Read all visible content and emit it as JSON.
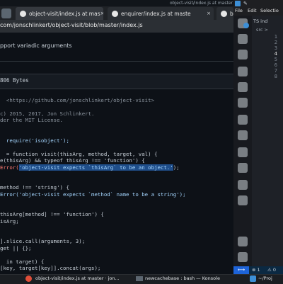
{
  "browser": {
    "window_title": "object-visit/index.js at master · jonsc",
    "tabs": [
      {
        "label": "object-visit/index.js at mas"
      },
      {
        "label": "enquirer/index.js at maste"
      },
      {
        "label": "bas"
      }
    ],
    "url": "com/jonschlinkert/object-visit/blob/master/index.js",
    "commit_message": "pport variadic arguments",
    "file_size": "806 Bytes",
    "code_lines": [
      "",
      "  <https://github.com/jonschlinkert/object-visit>",
      "",
      "c) 2015, 2017, Jon Schlinkert.",
      "der the MIT License.",
      "",
      "",
      "  require('isobject');",
      "",
      "  = function visit(thisArg, method, target, val) {",
      "e(thisArg) && typeof thisArg !== 'function') {",
      "Error('object-visit expects `thisArg` to be an object.');",
      "",
      "",
      "method !== 'string') {",
      "Error('object-visit expects `method` name to be a string');",
      "",
      "",
      "thisArg[method] !== 'function') {",
      "isArg;",
      "",
      "",
      "].slice.call(arguments, 3);",
      "get || {};",
      "",
      "  in target) {",
      "[key, target[key]].concat(args);"
    ]
  },
  "vscode": {
    "menu": [
      "File",
      "Edit",
      "Selectio"
    ],
    "explorer_header": "TS ind",
    "tree_item": "src >",
    "line_numbers": [
      "1",
      "2",
      "3",
      "4",
      "5",
      "6",
      "7",
      "8"
    ],
    "status_errors": "⊗ 1",
    "status_warnings": "⚠ 0"
  },
  "taskbar": {
    "items": [
      {
        "label": "object-visit/index.js at master · jon..."
      },
      {
        "label": "newcachebase : bash — Konsole"
      },
      {
        "label": "~/Proj"
      }
    ]
  }
}
